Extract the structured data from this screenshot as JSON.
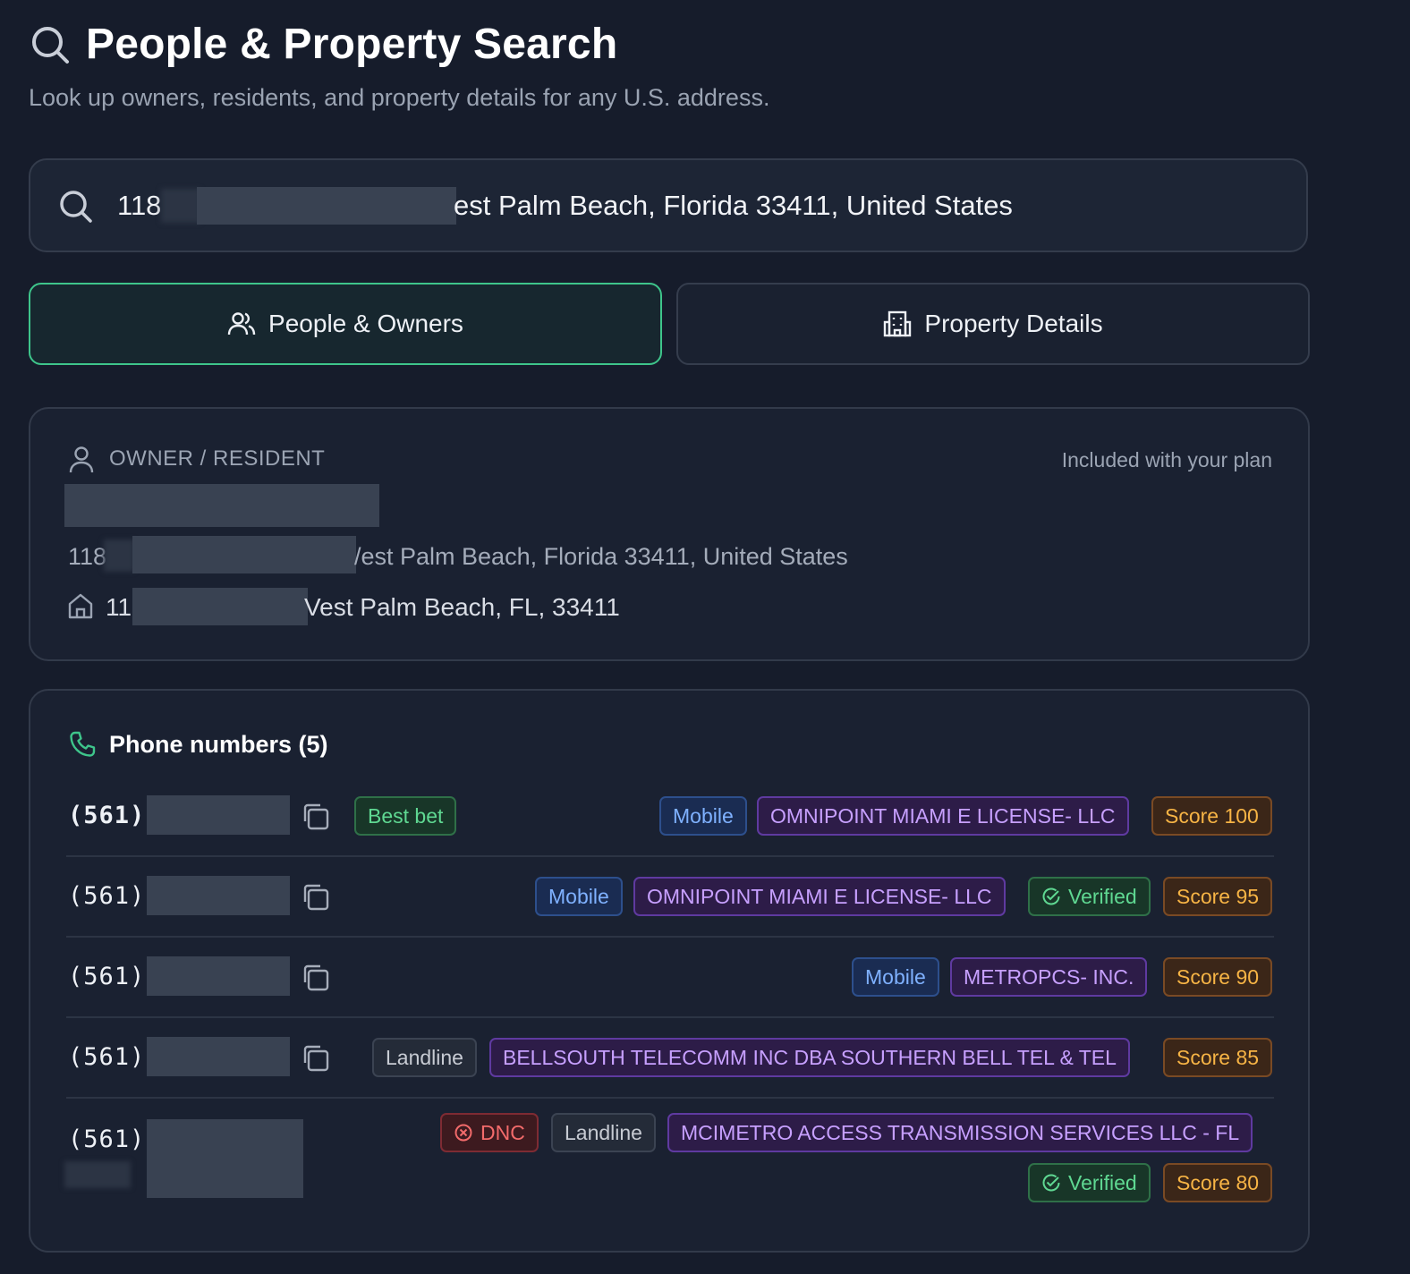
{
  "header": {
    "title": "People & Property Search",
    "subtitle": "Look up owners, residents, and property details for any U.S. address."
  },
  "search": {
    "value_start": "118",
    "value_end": "est Palm Beach, Florida 33411, United States"
  },
  "tabs": [
    {
      "label": "People & Owners",
      "active": true,
      "icon": "users-icon"
    },
    {
      "label": "Property Details",
      "active": false,
      "icon": "building-icon"
    }
  ],
  "owner": {
    "section_label": "OWNER / RESIDENT",
    "plan_note": "Included with your plan",
    "address_start": "118",
    "address_end": "/est Palm Beach, Florida 33411, United States",
    "property_start": "11",
    "property_end": "Vest Palm Beach, FL, 33411"
  },
  "phones": {
    "heading": "Phone numbers (5)",
    "rows": [
      {
        "prefix": "(561)",
        "best_bet": "Best bet",
        "line_type": "Mobile",
        "carrier": "OMNIPOINT MIAMI E LICENSE- LLC",
        "score": "Score 100"
      },
      {
        "prefix": "(561)",
        "line_type": "Mobile",
        "carrier": "OMNIPOINT MIAMI E LICENSE- LLC",
        "verified": "Verified",
        "score": "Score 95"
      },
      {
        "prefix": "(561)",
        "line_type": "Mobile",
        "carrier": "METROPCS- INC.",
        "score": "Score 90"
      },
      {
        "prefix": "(561)",
        "line_type": "Landline",
        "carrier": "BELLSOUTH TELECOMM INC DBA SOUTHERN BELL TEL & TEL",
        "score": "Score 85"
      },
      {
        "prefix": "(561)",
        "dnc": "DNC",
        "line_type": "Landline",
        "carrier": "MCIMETRO ACCESS TRANSMISSION SERVICES LLC - FL",
        "verified": "Verified",
        "score": "Score 80"
      }
    ]
  },
  "colors": {
    "background": "#161c2b",
    "accent_green": "#3ec58b",
    "best_bet": "#5fd892",
    "line_type": "#7fb1ff",
    "carrier": "#c7a0ff",
    "score": "#f7b445",
    "dnc": "#f36b6b"
  }
}
